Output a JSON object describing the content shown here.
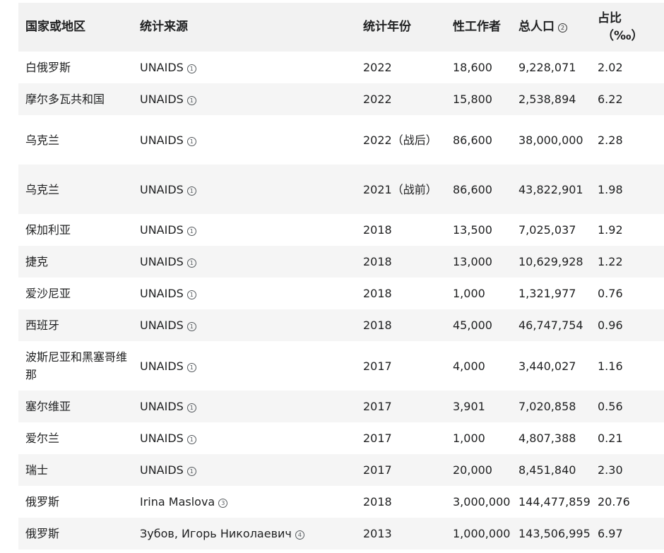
{
  "headers": {
    "country": "国家或地区",
    "source": "统计来源",
    "year": "统计年份",
    "workers": "性工作者",
    "population": "总人口",
    "population_ref": "2",
    "ratio": "占比",
    "ratio_unit": "（‰）"
  },
  "rows": [
    {
      "country": "白俄罗斯",
      "source": "UNAIDS",
      "ref": "1",
      "year": "2022",
      "workers": "18,600",
      "population": "9,228,071",
      "ratio": "2.02"
    },
    {
      "country": "摩尔多瓦共和国",
      "source": "UNAIDS",
      "ref": "1",
      "year": "2022",
      "workers": "15,800",
      "population": "2,538,894",
      "ratio": "6.22"
    },
    {
      "country": "乌克兰",
      "source": "UNAIDS",
      "ref": "1",
      "year": "2022（战后）",
      "workers": "86,600",
      "population": "38,000,000",
      "ratio": "2.28"
    },
    {
      "country": "乌克兰",
      "source": "UNAIDS",
      "ref": "1",
      "year": "2021（战前）",
      "workers": "86,600",
      "population": "43,822,901",
      "ratio": "1.98"
    },
    {
      "country": "保加利亚",
      "source": "UNAIDS",
      "ref": "1",
      "year": "2018",
      "workers": "13,500",
      "population": "7,025,037",
      "ratio": "1.92"
    },
    {
      "country": "捷克",
      "source": "UNAIDS",
      "ref": "1",
      "year": "2018",
      "workers": "13,000",
      "population": "10,629,928",
      "ratio": "1.22"
    },
    {
      "country": "爱沙尼亚",
      "source": "UNAIDS",
      "ref": "1",
      "year": "2018",
      "workers": "1,000",
      "population": "1,321,977",
      "ratio": "0.76"
    },
    {
      "country": "西班牙",
      "source": "UNAIDS",
      "ref": "1",
      "year": "2018",
      "workers": "45,000",
      "population": "46,747,754",
      "ratio": "0.96"
    },
    {
      "country": "波斯尼亚和黑塞哥维那",
      "source": "UNAIDS",
      "ref": "1",
      "year": "2017",
      "workers": "4,000",
      "population": "3,440,027",
      "ratio": "1.16"
    },
    {
      "country": "塞尔维亚",
      "source": "UNAIDS",
      "ref": "1",
      "year": "2017",
      "workers": "3,901",
      "population": "7,020,858",
      "ratio": "0.56"
    },
    {
      "country": "爱尔兰",
      "source": "UNAIDS",
      "ref": "1",
      "year": "2017",
      "workers": "1,000",
      "population": "4,807,388",
      "ratio": "0.21"
    },
    {
      "country": "瑞士",
      "source": "UNAIDS",
      "ref": "1",
      "year": "2017",
      "workers": "20,000",
      "population": "8,451,840",
      "ratio": "2.30"
    },
    {
      "country": "俄罗斯",
      "source": "Irina Maslova",
      "ref": "3",
      "year": "2018",
      "workers": "3,000,000",
      "population": "144,477,859",
      "ratio": "20.76"
    },
    {
      "country": "俄罗斯",
      "source": "Зубов, Игорь Николаевич",
      "ref": "4",
      "year": "2013",
      "workers": "1,000,000",
      "population": "143,506,995",
      "ratio": "6.97"
    }
  ]
}
